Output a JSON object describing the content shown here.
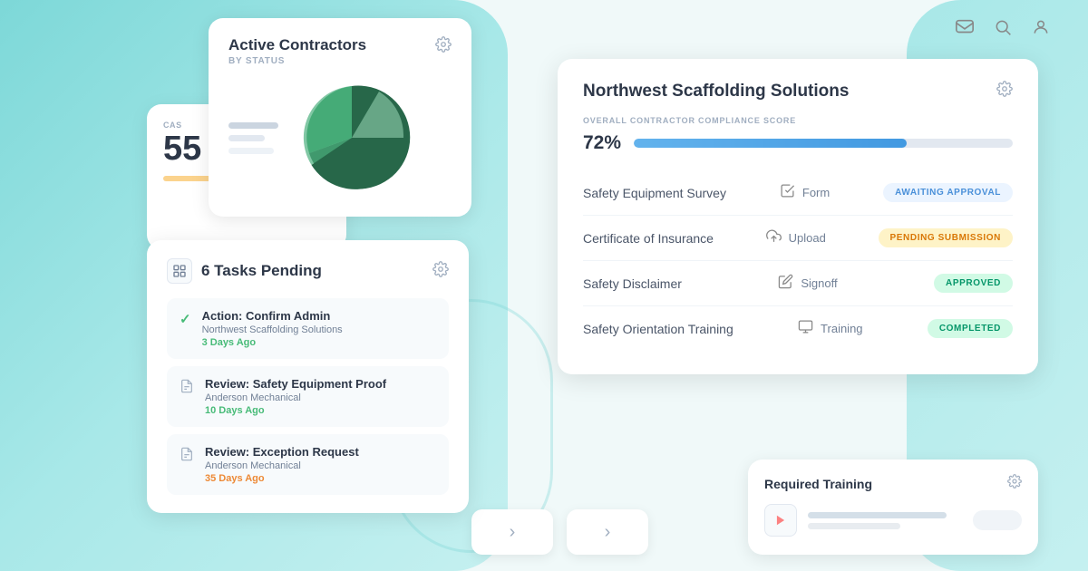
{
  "background": {
    "teal_color": "#7dd8d8"
  },
  "top_nav": {
    "icons": [
      "message-icon",
      "search-icon",
      "user-icon"
    ]
  },
  "contractors_card": {
    "title": "Active Contractors",
    "subtitle": "BY STATUS",
    "gear_label": "settings"
  },
  "cas_card": {
    "label": "CAS",
    "number": "55",
    "bar_color": "#fbd38d"
  },
  "tasks_card": {
    "title": "6 Tasks Pending",
    "icon_label": "tasks",
    "gear_label": "settings",
    "tasks": [
      {
        "name": "Action: Confirm Admin",
        "company": "Northwest Scaffolding Solutions",
        "time": "3 Days Ago",
        "time_class": "green",
        "icon_type": "check"
      },
      {
        "name": "Review: Safety Equipment Proof",
        "company": "Anderson Mechanical",
        "time": "10 Days Ago",
        "time_class": "green",
        "icon_type": "doc"
      },
      {
        "name": "Review: Exception Request",
        "company": "Anderson Mechanical",
        "time": "35 Days Ago",
        "time_class": "yellow",
        "icon_type": "doc"
      }
    ]
  },
  "nw_card": {
    "title": "Northwest Scaffolding Solutions",
    "gear_label": "settings",
    "compliance_label": "OVERALL CONTRACTOR COMPLIANCE SCORE",
    "compliance_pct": "72%",
    "progress_fill_pct": 72,
    "rows": [
      {
        "name": "Safety Equipment Survey",
        "type_icon": "form-icon",
        "type_label": "Form",
        "badge": "AWAITING APPROVAL",
        "badge_class": "badge-awaiting"
      },
      {
        "name": "Certificate of Insurance",
        "type_icon": "upload-icon",
        "type_label": "Upload",
        "badge": "PENDING SUBMISSION",
        "badge_class": "badge-pending"
      },
      {
        "name": "Safety Disclaimer",
        "type_icon": "signoff-icon",
        "type_label": "Signoff",
        "badge": "APPROVED",
        "badge_class": "badge-approved"
      },
      {
        "name": "Safety Orientation Training",
        "type_icon": "training-icon",
        "type_label": "Training",
        "badge": "COMPLETED",
        "badge_class": "badge-completed"
      }
    ]
  },
  "training_card": {
    "title": "Required Training",
    "gear_label": "settings"
  },
  "nav_small": {
    "chevron_right": "›"
  }
}
